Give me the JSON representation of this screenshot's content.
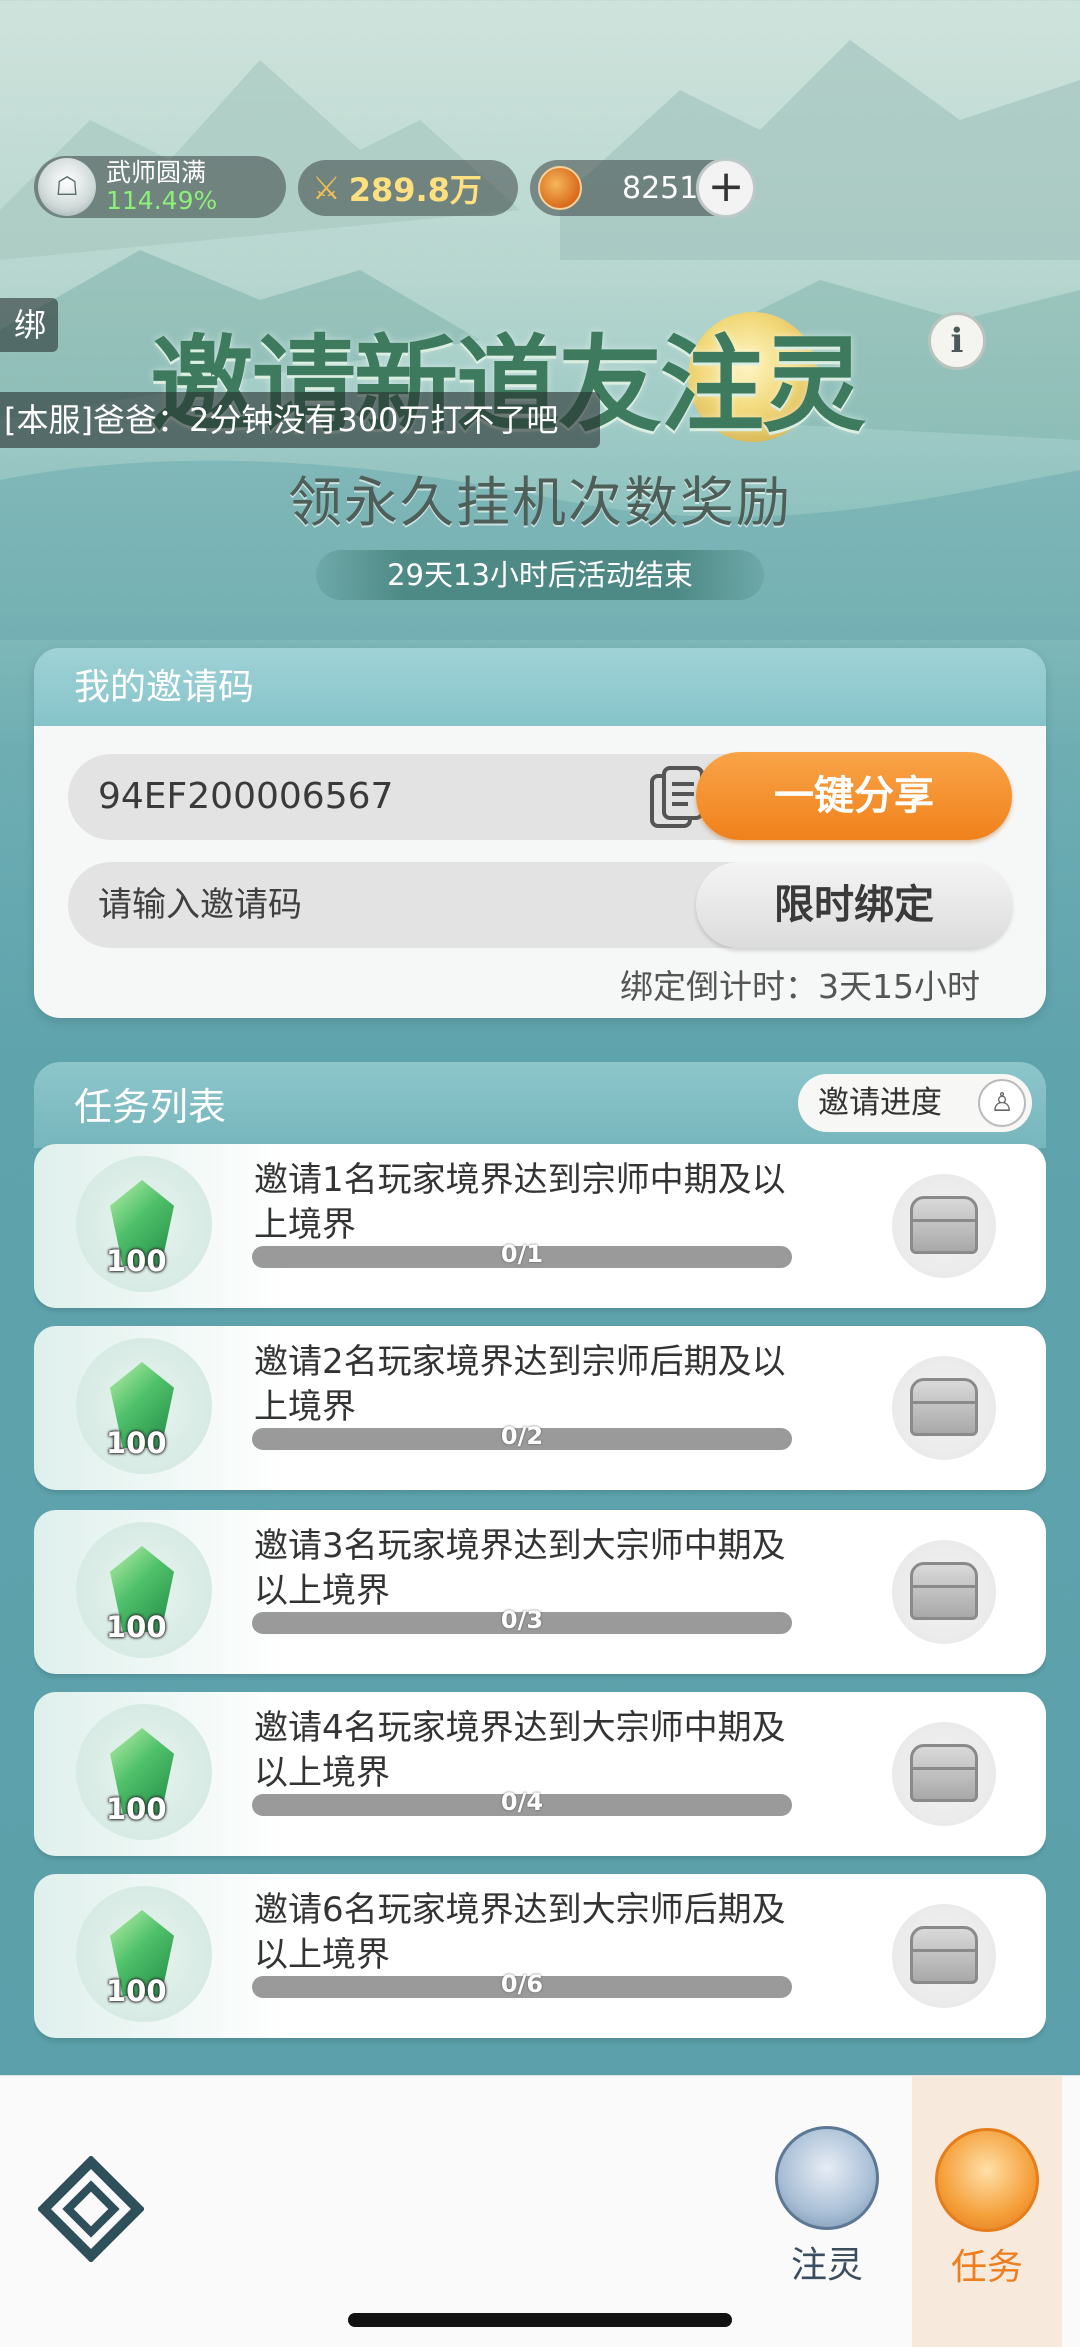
{
  "status": {
    "rank_name": "武师圆满",
    "rank_percent": "114.49%",
    "power": "289.8万",
    "jade_count": "8251",
    "plus_label": "+"
  },
  "chat": {
    "tag": "绑定",
    "message": "[本服]爸爸：2分钟没有300万打不了吧"
  },
  "banner": {
    "title": "邀请新道友注灵",
    "subtitle": "领永久挂机次数奖励",
    "countdown": "29天13小时后活动结束",
    "info_label": "i"
  },
  "invite": {
    "header": "我的邀请码",
    "code": "94EF200006567",
    "share_label": "一键分享",
    "input_placeholder": "请输入邀请码",
    "bind_label": "限时绑定",
    "bind_countdown": "绑定倒计时：3天15小时"
  },
  "tasks": {
    "header": "任务列表",
    "progress_label": "邀请进度",
    "items": [
      {
        "desc": "邀请1名玩家境界达到宗师中期及以上境界",
        "reward": "100",
        "progress_text": "0/1",
        "progress": 0
      },
      {
        "desc": "邀请2名玩家境界达到宗师后期及以上境界",
        "reward": "100",
        "progress_text": "0/2",
        "progress": 0
      },
      {
        "desc": "邀请3名玩家境界达到大宗师中期及以上境界",
        "reward": "100",
        "progress_text": "0/3",
        "progress": 0
      },
      {
        "desc": "邀请4名玩家境界达到大宗师中期及以上境界",
        "reward": "100",
        "progress_text": "0/4",
        "progress": 0
      },
      {
        "desc": "邀请6名玩家境界达到大宗师后期及以上境界",
        "reward": "100",
        "progress_text": "0/6",
        "progress": 0
      }
    ]
  },
  "nav": {
    "zhuling_label": "注灵",
    "renwu_label": "任务"
  },
  "colors": {
    "accent_orange": "#f0811b",
    "title_green": "#3d7a5e",
    "panel_header": "#86c4ca"
  }
}
